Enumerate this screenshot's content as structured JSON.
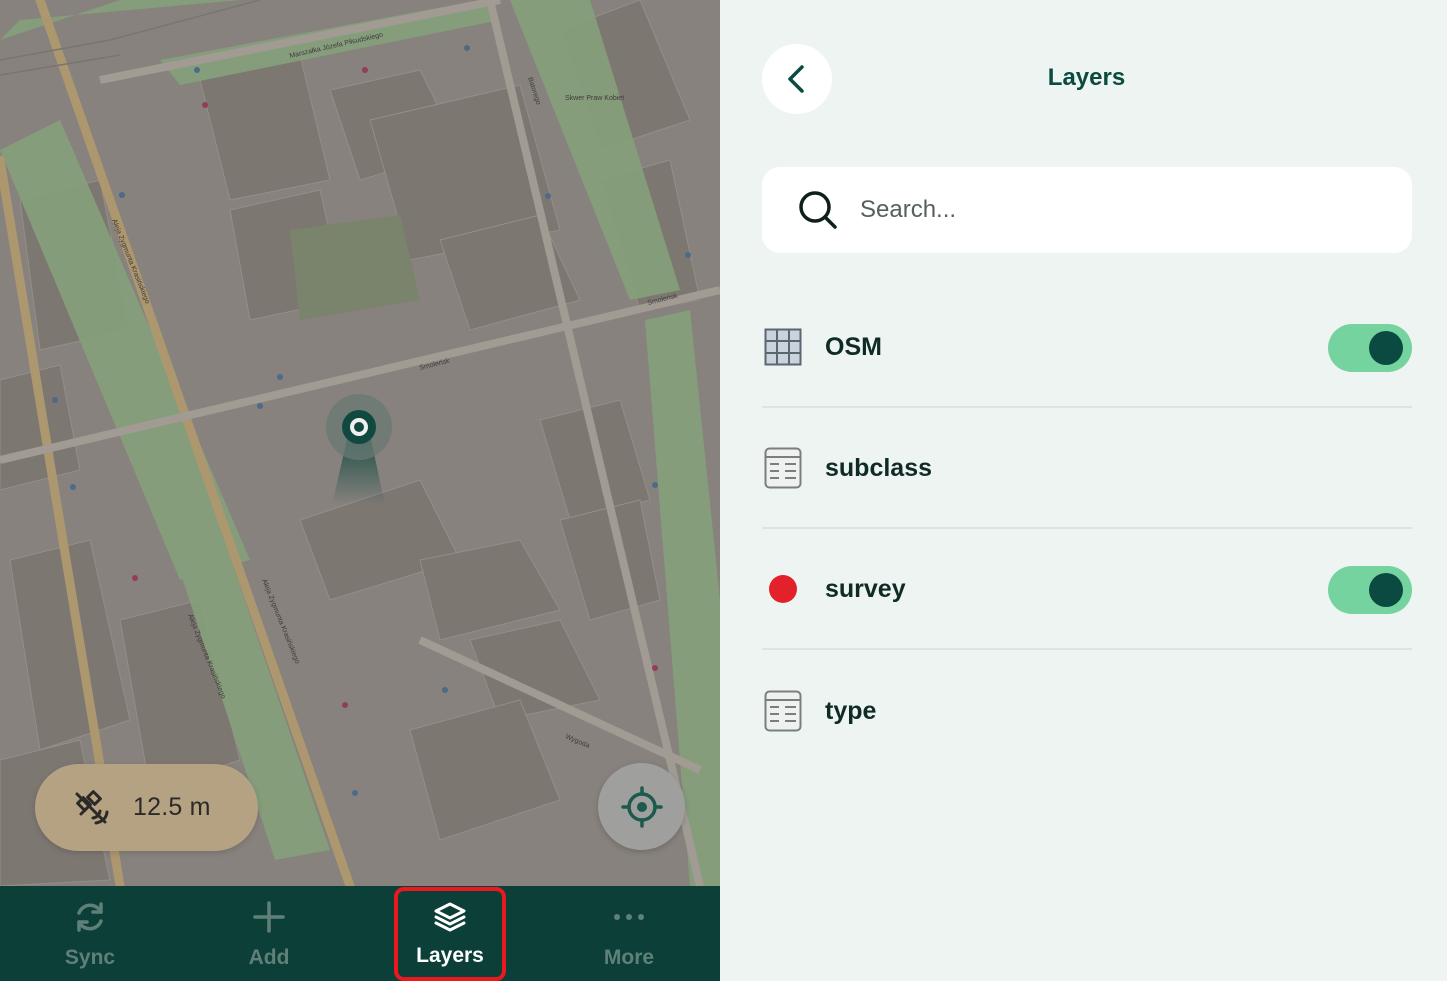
{
  "map": {
    "gps_accuracy": "12.5 m",
    "street_labels": [
      "Smoleńsk",
      "Smoleńsk",
      "Wygoda",
      "Aleja Zygmunta Krasińskiego",
      "Aleja Zygmunta Krasińskiego",
      "Aleja Zygmunta Krasińskiego",
      "Marszałka Józefa Piłsudskiego",
      "Batorego",
      "Skwer Praw Kobiet"
    ],
    "icons": {
      "gps": "satellite-icon",
      "locate": "crosshair-icon",
      "marker": "location-pin-icon"
    }
  },
  "bottom_nav": {
    "items": [
      {
        "label": "Sync",
        "icon": "sync-icon"
      },
      {
        "label": "Add",
        "icon": "plus-icon"
      },
      {
        "label": "Layers",
        "icon": "layers-icon",
        "active": true
      },
      {
        "label": "More",
        "icon": "more-dots-icon"
      }
    ]
  },
  "layers_panel": {
    "title": "Layers",
    "search_placeholder": "Search...",
    "layers": [
      {
        "name": "OSM",
        "icon": "raster-grid-icon",
        "toggle": true,
        "enabled": true
      },
      {
        "name": "subclass",
        "icon": "table-icon",
        "toggle": false
      },
      {
        "name": "survey",
        "icon": "point-dot-icon",
        "color": "#e3212b",
        "toggle": true,
        "enabled": true
      },
      {
        "name": "type",
        "icon": "table-icon",
        "toggle": false
      }
    ]
  },
  "colors": {
    "accent": "#0b4a40",
    "toggle_on": "#74d39e",
    "highlight": "#e8191f",
    "nav_bg": "#0b3f37",
    "panel_bg": "#eef4f1"
  }
}
